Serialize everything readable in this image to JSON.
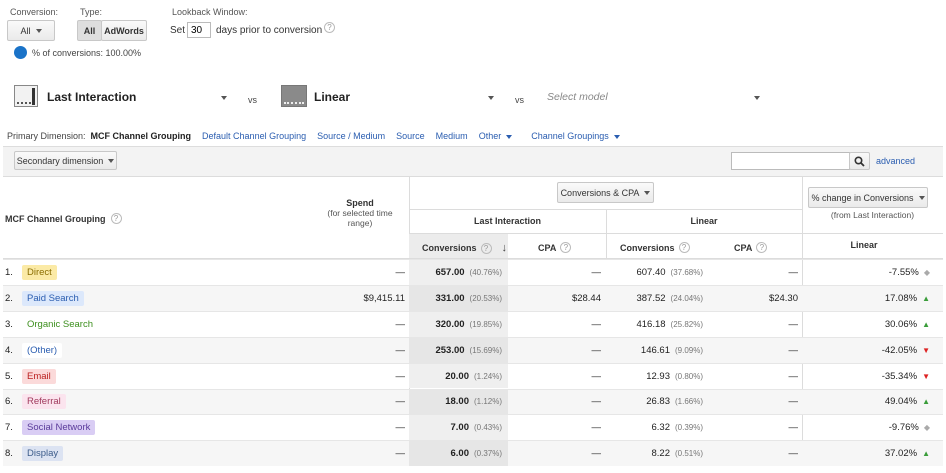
{
  "filters": {
    "conversion_label": "Conversion:",
    "conversion_value": "All",
    "type_label": "Type:",
    "type_all": "All",
    "type_adwords": "AdWords",
    "lookback_label": "Lookback Window:",
    "lookback_set": "Set",
    "lookback_days": "30",
    "lookback_suffix": "days prior to conversion",
    "help_glyph": "?",
    "pct_conversions": "% of conversions: 100.00%"
  },
  "models": {
    "model1": "Last Interaction",
    "vs1": "vs",
    "model2": "Linear",
    "vs2": "vs",
    "model3_placeholder": "Select model"
  },
  "dimension": {
    "label": "Primary Dimension:",
    "active": "MCF Channel Grouping",
    "links": [
      "Default Channel Grouping",
      "Source / Medium",
      "Source",
      "Medium",
      "Other",
      "Channel Groupings"
    ]
  },
  "toolbar": {
    "secondary": "Secondary dimension",
    "advanced": "advanced"
  },
  "table": {
    "col_dimension": "MCF Channel Grouping",
    "col_spend": "Spend",
    "col_spend_sub": "(for selected time range)",
    "metric_select": "Conversions & CPA",
    "group1": "Last Interaction",
    "group2": "Linear",
    "change_select": "% change in Conversions",
    "change_sub": "(from Last Interaction)",
    "col_conv": "Conversions",
    "col_cpa": "CPA",
    "col_change_model": "Linear",
    "rows": [
      {
        "num": "1.",
        "name": "Direct",
        "spend": "—",
        "li_conv": "657.00",
        "li_pct": "(40.76%)",
        "li_cpa": "—",
        "lin_conv": "607.40",
        "lin_pct": "(37.68%)",
        "lin_cpa": "—",
        "change": "-7.55%",
        "dir": "neutral",
        "bg": "#fbeaa6",
        "fg": "#8a6d00"
      },
      {
        "num": "2.",
        "name": "Paid Search",
        "spend": "$9,415.11",
        "li_conv": "331.00",
        "li_pct": "(20.53%)",
        "li_cpa": "$28.44",
        "lin_conv": "387.52",
        "lin_pct": "(24.04%)",
        "lin_cpa": "$24.30",
        "change": "17.08%",
        "dir": "up",
        "bg": "#dce8fb",
        "fg": "#2a5db0"
      },
      {
        "num": "3.",
        "name": "Organic Search",
        "spend": "—",
        "li_conv": "320.00",
        "li_pct": "(19.85%)",
        "li_cpa": "—",
        "lin_conv": "416.18",
        "lin_pct": "(25.82%)",
        "lin_cpa": "—",
        "change": "30.06%",
        "dir": "up",
        "bg": "#ffffff",
        "fg": "#3d8f1e"
      },
      {
        "num": "4.",
        "name": "(Other)",
        "spend": "—",
        "li_conv": "253.00",
        "li_pct": "(15.69%)",
        "li_cpa": "—",
        "lin_conv": "146.61",
        "lin_pct": "(9.09%)",
        "lin_cpa": "—",
        "change": "-42.05%",
        "dir": "down",
        "bg": "#ffffff",
        "fg": "#2a5db0"
      },
      {
        "num": "5.",
        "name": "Email",
        "spend": "—",
        "li_conv": "20.00",
        "li_pct": "(1.24%)",
        "li_cpa": "—",
        "lin_conv": "12.93",
        "lin_pct": "(0.80%)",
        "lin_cpa": "—",
        "change": "-35.34%",
        "dir": "down",
        "bg": "#fbdada",
        "fg": "#b22"
      },
      {
        "num": "6.",
        "name": "Referral",
        "spend": "—",
        "li_conv": "18.00",
        "li_pct": "(1.12%)",
        "li_cpa": "—",
        "lin_conv": "26.83",
        "lin_pct": "(1.66%)",
        "lin_cpa": "—",
        "change": "49.04%",
        "dir": "up",
        "bg": "#fbe4ee",
        "fg": "#a03a5d"
      },
      {
        "num": "7.",
        "name": "Social Network",
        "spend": "—",
        "li_conv": "7.00",
        "li_pct": "(0.43%)",
        "li_cpa": "—",
        "lin_conv": "6.32",
        "lin_pct": "(0.39%)",
        "lin_cpa": "—",
        "change": "-9.76%",
        "dir": "neutral",
        "bg": "#d9cdf4",
        "fg": "#5a3a9a"
      },
      {
        "num": "8.",
        "name": "Display",
        "spend": "—",
        "li_conv": "6.00",
        "li_pct": "(0.37%)",
        "li_cpa": "—",
        "lin_conv": "8.22",
        "lin_pct": "(0.51%)",
        "lin_cpa": "—",
        "change": "37.02%",
        "dir": "up",
        "bg": "#dce3f2",
        "fg": "#3b5b8a"
      }
    ]
  },
  "colors": {
    "accent": "#2a5db0",
    "pie": "#1a73c8",
    "up": "#3a9d3a",
    "down": "#dd2222"
  },
  "icons": {
    "search": "search-icon",
    "sort": "sort-down-icon"
  }
}
